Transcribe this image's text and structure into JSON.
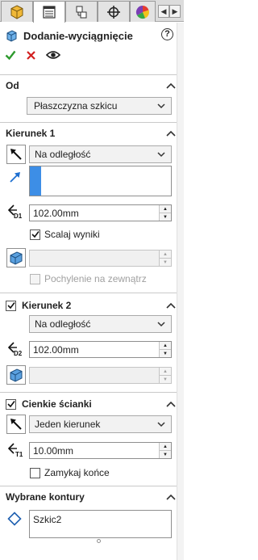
{
  "tabs": [
    {
      "name": "featuremanager",
      "icon": "featuremanager-icon"
    },
    {
      "name": "propertymanager",
      "icon": "propertymanager-icon",
      "active": true
    },
    {
      "name": "configurationmanager",
      "icon": "configurationmanager-icon"
    },
    {
      "name": "dimxpertmanager",
      "icon": "dimxpert-icon"
    },
    {
      "name": "displaymanager",
      "icon": "displaymanager-icon"
    }
  ],
  "header": {
    "title": "Dodanie-wyciągnięcie",
    "help": "?"
  },
  "od": {
    "title": "Od",
    "select_value": "Płaszczyzna szkicu"
  },
  "kierunek1": {
    "title": "Kierunek 1",
    "end_condition": "Na odległość",
    "depth": "102.00mm",
    "merge_label": "Scalaj wyniki",
    "merge_checked": true,
    "draft_outward_label": "Pochylenie na zewnątrz",
    "draft_outward_checked": false
  },
  "kierunek2": {
    "title": "Kierunek 2",
    "checked": true,
    "end_condition": "Na odległość",
    "depth": "102.00mm"
  },
  "cienkie": {
    "title": "Cienkie ścianki",
    "checked": true,
    "type": "Jeden kierunek",
    "thickness": "10.00mm",
    "cap_ends_label": "Zamykaj końce",
    "cap_ends_checked": false
  },
  "kontury": {
    "title": "Wybrane kontury",
    "items": [
      "Szkic2"
    ]
  },
  "colors": {
    "accent_blue": "#3d8ee6",
    "ok_green": "#2e9a2e",
    "cancel_red": "#d22020"
  }
}
